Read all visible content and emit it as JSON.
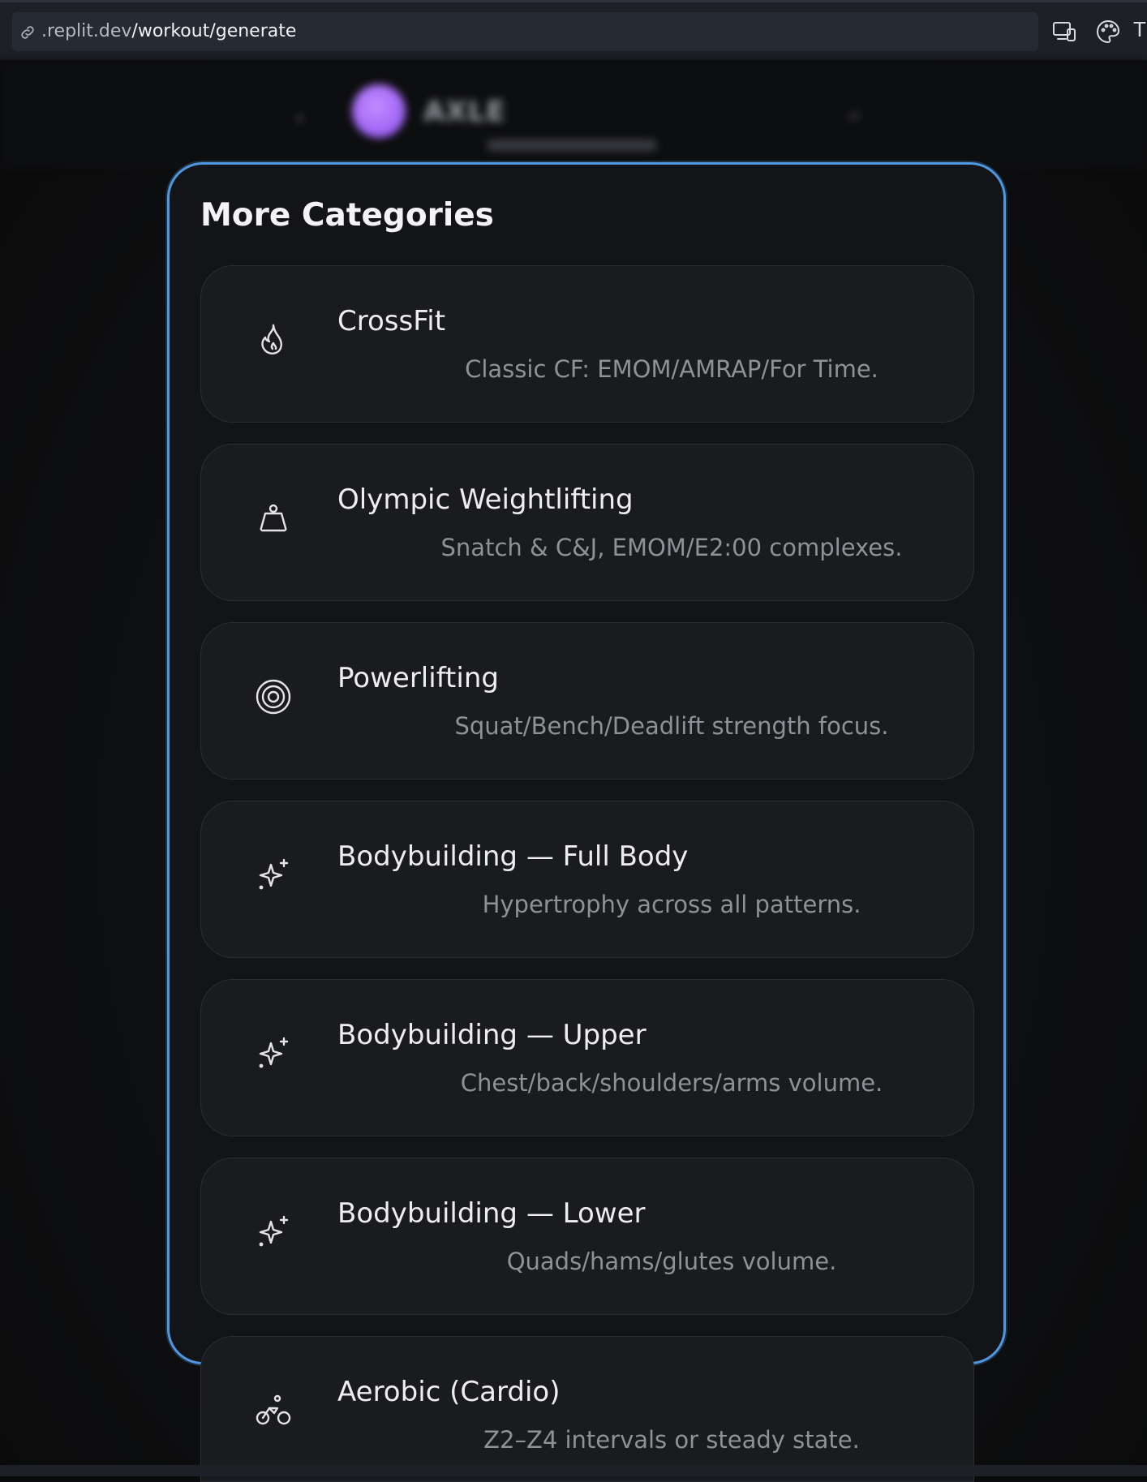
{
  "browser": {
    "url_host": ".replit.dev",
    "url_path": "/workout/generate",
    "toolbar_letter": "T"
  },
  "app_header": {
    "title": "AXLE"
  },
  "modal": {
    "title": "More Categories",
    "categories": [
      {
        "title": "CrossFit",
        "desc": "Classic CF: EMOM/AMRAP/For Time.",
        "icon": "flame-icon"
      },
      {
        "title": "Olympic Weightlifting",
        "desc": "Snatch & C&J, EMOM/E2:00 complexes.",
        "icon": "weight-icon"
      },
      {
        "title": "Powerlifting",
        "desc": "Squat/Bench/Deadlift strength focus.",
        "icon": "target-icon"
      },
      {
        "title": "Bodybuilding — Full Body",
        "desc": "Hypertrophy across all patterns.",
        "icon": "sparkles-icon"
      },
      {
        "title": "Bodybuilding — Upper",
        "desc": "Chest/back/shoulders/arms volume.",
        "icon": "sparkles-icon"
      },
      {
        "title": "Bodybuilding — Lower",
        "desc": "Quads/hams/glutes volume.",
        "icon": "sparkles-icon"
      },
      {
        "title": "Aerobic (Cardio)",
        "desc": "Z2–Z4 intervals or steady state.",
        "icon": "bike-icon"
      }
    ]
  },
  "colors": {
    "modal_border": "#4f97e0",
    "card_bg": "#1a1b1f",
    "accent_avatar": "#a66bf7"
  }
}
